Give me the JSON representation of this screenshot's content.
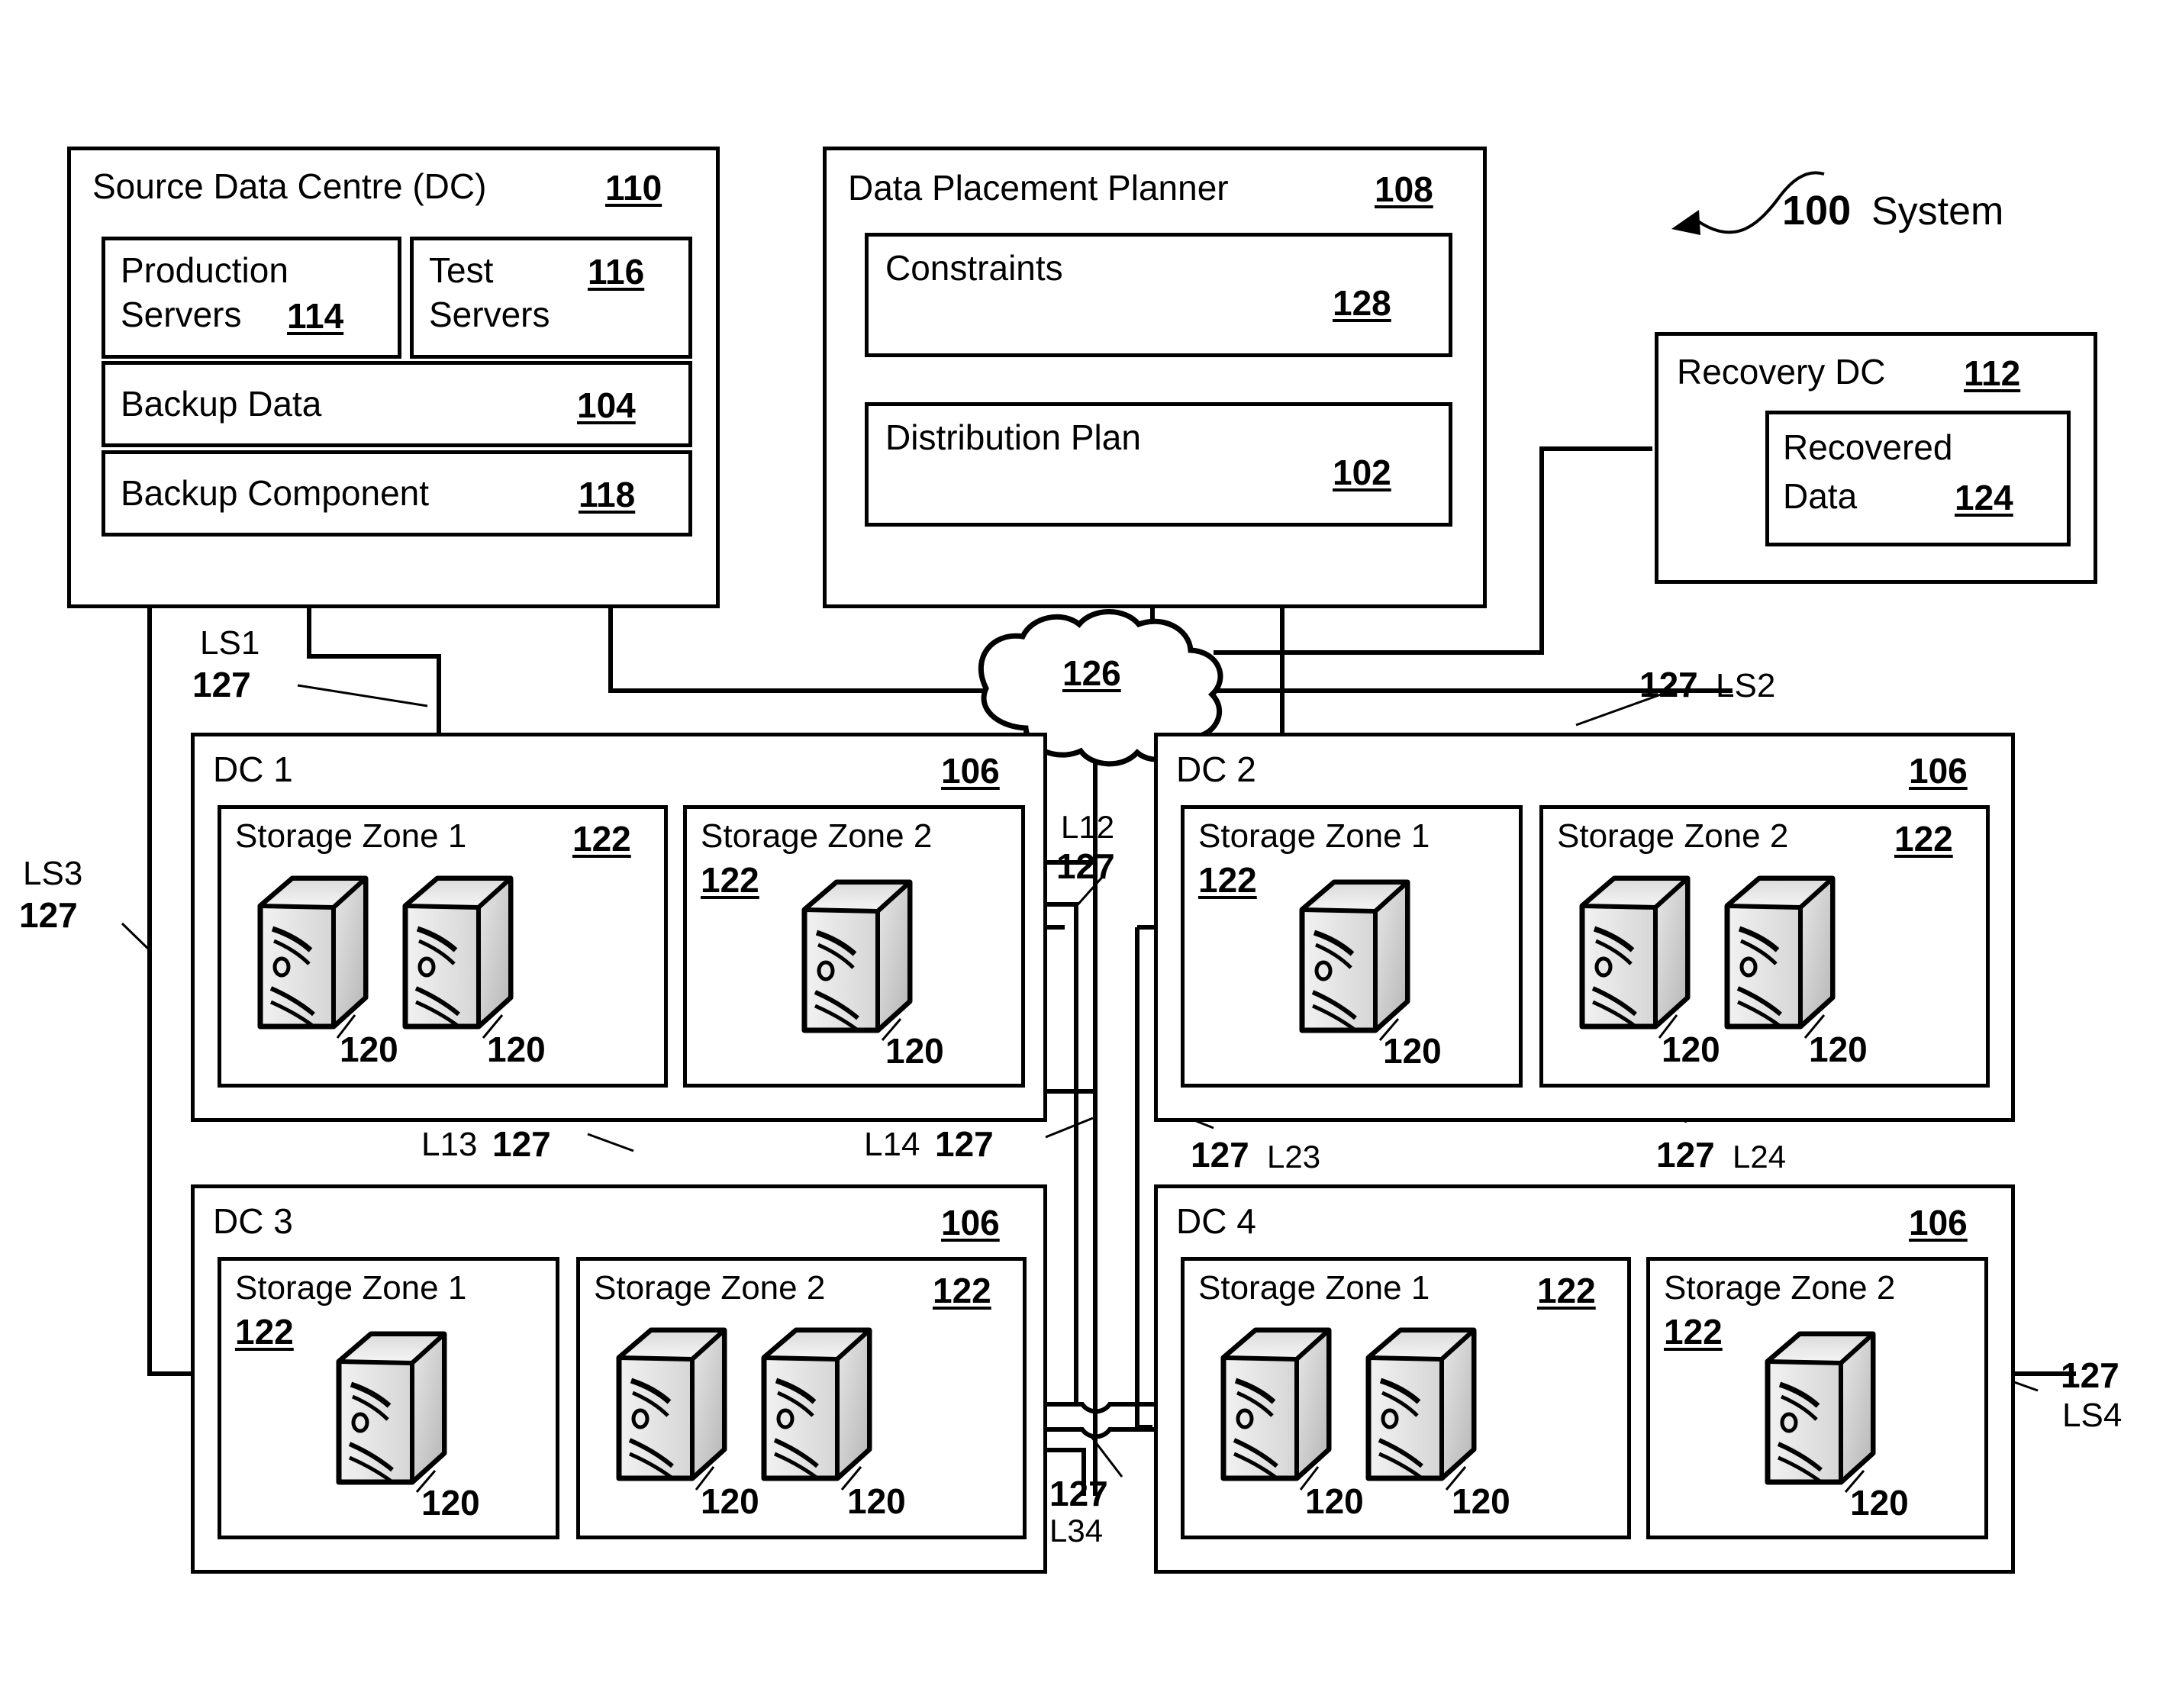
{
  "system": {
    "ref": "100",
    "label": "System"
  },
  "source_dc": {
    "title": "Source Data Centre (DC)",
    "ref": "110",
    "production_servers": {
      "line1": "Production",
      "line2": "Servers",
      "ref": "114"
    },
    "test_servers": {
      "line1": "Test",
      "line2": "Servers",
      "ref": "116"
    },
    "backup_data": {
      "title": "Backup Data",
      "ref": "104"
    },
    "backup_component": {
      "title": "Backup Component",
      "ref": "118"
    }
  },
  "planner": {
    "title": "Data Placement Planner",
    "ref": "108",
    "constraints": {
      "title": "Constraints",
      "ref": "128"
    },
    "distribution_plan": {
      "title": "Distribution Plan",
      "ref": "102"
    }
  },
  "recovery_dc": {
    "title": "Recovery DC",
    "ref": "112",
    "recovered_data": {
      "line1": "Recovered",
      "line2": "Data",
      "ref": "124"
    }
  },
  "network": {
    "ref": "126"
  },
  "data_centres": [
    {
      "name": "DC 1",
      "ref": "106",
      "zones": [
        {
          "name": "Storage Zone 1",
          "ref": "122",
          "servers": [
            {
              "ref": "120"
            },
            {
              "ref": "120"
            }
          ]
        },
        {
          "name": "Storage Zone 2",
          "ref": "122",
          "servers": [
            {
              "ref": "120"
            }
          ]
        }
      ]
    },
    {
      "name": "DC 2",
      "ref": "106",
      "zones": [
        {
          "name": "Storage Zone 1",
          "ref": "122",
          "servers": [
            {
              "ref": "120"
            }
          ]
        },
        {
          "name": "Storage Zone 2",
          "ref": "122",
          "servers": [
            {
              "ref": "120"
            },
            {
              "ref": "120"
            }
          ]
        }
      ]
    },
    {
      "name": "DC 3",
      "ref": "106",
      "zones": [
        {
          "name": "Storage Zone 1",
          "ref": "122",
          "servers": [
            {
              "ref": "120"
            }
          ]
        },
        {
          "name": "Storage Zone 2",
          "ref": "122",
          "servers": [
            {
              "ref": "120"
            },
            {
              "ref": "120"
            }
          ]
        }
      ]
    },
    {
      "name": "DC 4",
      "ref": "106",
      "zones": [
        {
          "name": "Storage Zone 1",
          "ref": "122",
          "servers": [
            {
              "ref": "120"
            },
            {
              "ref": "120"
            }
          ]
        },
        {
          "name": "Storage Zone 2",
          "ref": "122",
          "servers": [
            {
              "ref": "120"
            }
          ]
        }
      ]
    }
  ],
  "links": [
    {
      "id": "LS1",
      "name": "LS1",
      "ref": "127"
    },
    {
      "id": "LS2",
      "name": "LS2",
      "ref": "127"
    },
    {
      "id": "LS3",
      "name": "LS3",
      "ref": "127"
    },
    {
      "id": "LS4",
      "name": "LS4",
      "ref": "127"
    },
    {
      "id": "L12",
      "name": "L12",
      "ref": "127"
    },
    {
      "id": "L13",
      "name": "L13",
      "ref": "127"
    },
    {
      "id": "L14",
      "name": "L14",
      "ref": "127"
    },
    {
      "id": "L23",
      "name": "L23",
      "ref": "127"
    },
    {
      "id": "L24",
      "name": "L24",
      "ref": "127"
    },
    {
      "id": "L34",
      "name": "L34",
      "ref": "127"
    }
  ],
  "colors": {
    "stroke": "#000000",
    "background": "#ffffff"
  }
}
